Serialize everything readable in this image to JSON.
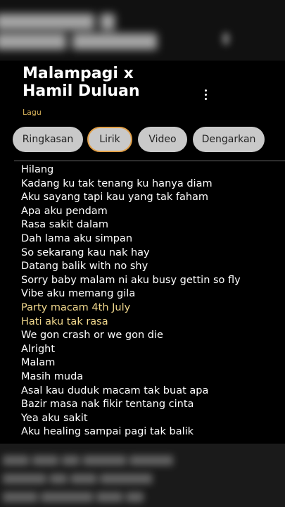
{
  "header": {
    "title_line1": "Malampagi x",
    "title_line2": "Hamil Duluan",
    "subtitle": "Lagu",
    "more_icon": "more-vertical-icon"
  },
  "tabs": [
    {
      "label": "Ringkasan",
      "active": false
    },
    {
      "label": "Lirik",
      "active": true
    },
    {
      "label": "Video",
      "active": false
    },
    {
      "label": "Dengarkan",
      "active": false
    }
  ],
  "lyrics": [
    "Hilang",
    "Kadang ku tak tenang ku hanya diam",
    "Aku sayang tapi kau yang tak faham",
    "Apa aku pendam",
    "Rasa sakit dalam",
    "Dah lama aku simpan",
    "So sekarang kau nak hay",
    "Datang balik with no shy",
    "Sorry baby malam ni aku busy gettin so fly",
    "Vibe aku memang gila",
    "Party macam 4th July",
    "Hati aku tak rasa",
    "We gon crash or we gon die",
    "Alright",
    "Malam",
    "Masih muda",
    "Asal kau duduk macam tak buat apa",
    "Bazir masa nak fikir tentang cinta",
    "Yea aku sakit",
    "Aku healing sampai pagi tak balik"
  ],
  "colors": {
    "accent": "#e2a14a",
    "highlight_lyric": "#f1d88d",
    "chip_bg": "#c9c9c9",
    "subtitle": "#d7b25b"
  }
}
